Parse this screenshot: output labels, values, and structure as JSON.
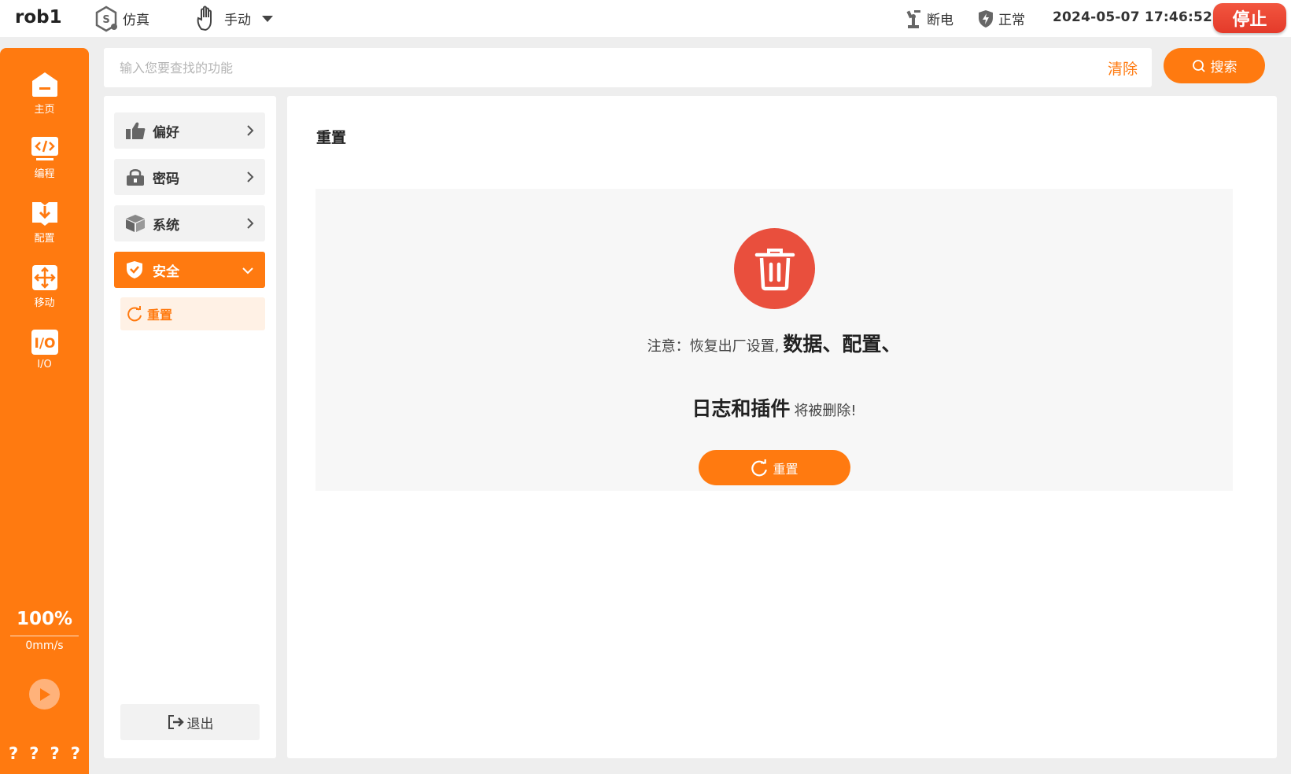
{
  "header": {
    "robot_name": "rob1",
    "simulation_label": "仿真",
    "mode_label": "手动",
    "power_label": "断电",
    "safety_label": "正常",
    "datetime": "2024-05-07 17:46:52",
    "stop_label": "停止"
  },
  "rail": {
    "items": [
      {
        "label": "主页",
        "icon": "home-icon"
      },
      {
        "label": "编程",
        "icon": "code-icon"
      },
      {
        "label": "配置",
        "icon": "download-config-icon"
      },
      {
        "label": "移动",
        "icon": "move-arrows-icon"
      },
      {
        "label": "I/O",
        "icon": "io-icon"
      }
    ],
    "speed_percent": "100%",
    "speed_value": "0mm/s",
    "bottom_marks": [
      "?",
      "?",
      "?",
      "?"
    ]
  },
  "search": {
    "placeholder": "输入您要查找的功能",
    "value": "",
    "clear_label": "清除",
    "search_label": "搜索"
  },
  "menu": {
    "items": [
      {
        "label": "偏好",
        "icon": "thumbs-up-icon"
      },
      {
        "label": "密码",
        "icon": "lock-icon"
      },
      {
        "label": "系统",
        "icon": "cube-icon"
      },
      {
        "label": "安全",
        "icon": "shield-check-icon"
      }
    ],
    "sub_item": "重置",
    "logout_label": "退出"
  },
  "main": {
    "title": "重置",
    "warning_prefix": "注意：恢复出厂设置,",
    "warning_bold_1": "数据、配置、",
    "warning_bold_2": "日志和插件",
    "warning_suffix": "将被删除!",
    "reset_button_label": "重置"
  },
  "colors": {
    "accent": "#ff7a10",
    "danger": "#e94f3d",
    "stop": "#e43a2a"
  }
}
